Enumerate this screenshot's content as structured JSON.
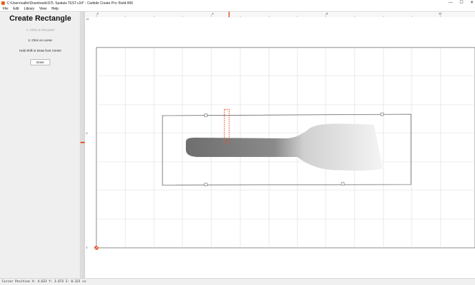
{
  "window": {
    "title": "C:\\Users\\sallie\\Downloads\\STL Spatula TEST.c2d* - Carbide Create Pro: Build 866",
    "controls": {
      "minimize": "—",
      "maximize": "☐",
      "close": "✕"
    }
  },
  "menu": [
    "File",
    "Edit",
    "Library",
    "View",
    "Help"
  ],
  "tool": {
    "title": "Create Rectangle",
    "step1": "1. Click on first point",
    "step2": "2. Click on corner",
    "hint": "Hold Shift to Draw from Center",
    "done_label": "Done"
  },
  "ruler": {
    "top_labels": [
      "0",
      "4",
      "8",
      "12"
    ],
    "left_labels": [
      "10",
      "5",
      "0"
    ]
  },
  "status": {
    "cursor": "Cursor Position X: 4.623 Y: 3.673 Z: 0.321 in"
  },
  "colors": {
    "accent": "#e8562a",
    "grid": "#d8d8d8",
    "outline": "#555555"
  }
}
